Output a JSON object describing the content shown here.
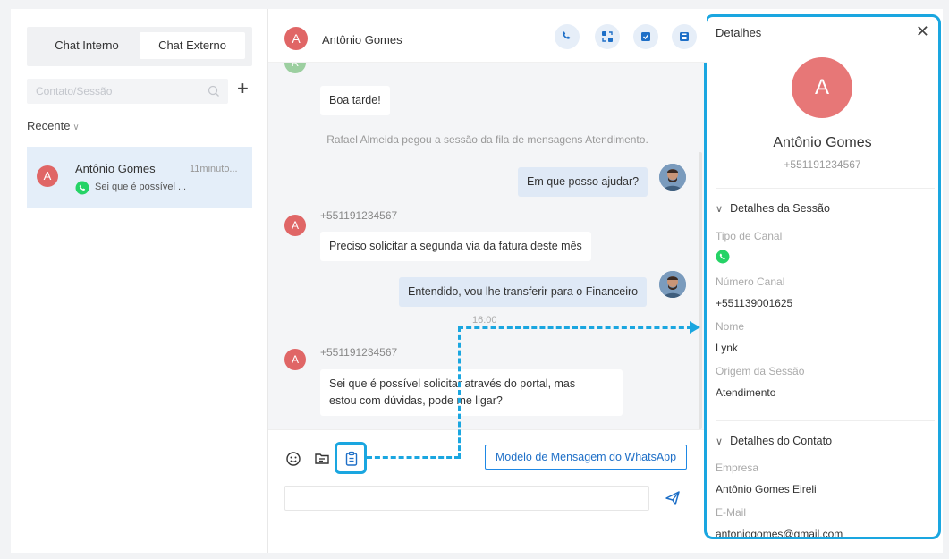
{
  "tabs": {
    "internal": "Chat Interno",
    "external": "Chat Externo"
  },
  "search": {
    "placeholder": "Contato/Sessão"
  },
  "recent": {
    "label": "Recente"
  },
  "contacts": [
    {
      "initial": "A",
      "name": "Antônio Gomes",
      "time": "11minuto...",
      "preview": "Sei que é possível ..."
    }
  ],
  "chat": {
    "header_initial": "A",
    "header_name": "Antônio Gomes",
    "messages": {
      "m1_text": "Boa tarde!",
      "sys1": "Rafael Almeida pegou a sessão da fila de mensagens Atendimento.",
      "m2_text": "Em que posso ajudar?",
      "m3_sender": "+551191234567",
      "m3_initial": "A",
      "m3_text": "Preciso solicitar a segunda via da fatura deste mês",
      "m4_text": "Entendido, vou lhe transferir para o Financeiro",
      "timestamp": "16:00",
      "m5_sender": "+551191234567",
      "m5_initial": "A",
      "m5_text_line1": "Sei que é possível solicitar através do portal, mas",
      "m5_text_line2": "estou com dúvidas, pode me ligar?"
    },
    "template_button": "Modelo de Mensagem do WhatsApp"
  },
  "details": {
    "title": "Detalhes",
    "initial": "A",
    "name": "Antônio Gomes",
    "phone": "+551191234567",
    "session_section": "Detalhes da Sessão",
    "channel_type_label": "Tipo de Canal",
    "channel_number_label": "Número Canal",
    "channel_number": "+551139001625",
    "name_label": "Nome",
    "name_value": "Lynk",
    "origin_label": "Origem da Sessão",
    "origin_value": "Atendimento",
    "contact_section": "Detalhes do Contato",
    "company_label": "Empresa",
    "company_value": "Antônio Gomes Eireli",
    "email_label": "E-Mail",
    "email_value": "antoniogomes@gmail.com"
  },
  "colors": {
    "accent": "#1aa6e0",
    "avatar": "#e06666",
    "whatsapp": "#25d366",
    "selected": "#e4eef9"
  },
  "icons": [
    "search-icon",
    "plus-icon",
    "whatsapp-icon",
    "phone-icon",
    "transfer-icon",
    "ticket-icon",
    "archive-icon",
    "emoji-icon",
    "folder-icon",
    "clipboard-icon",
    "send-icon",
    "close-icon"
  ]
}
